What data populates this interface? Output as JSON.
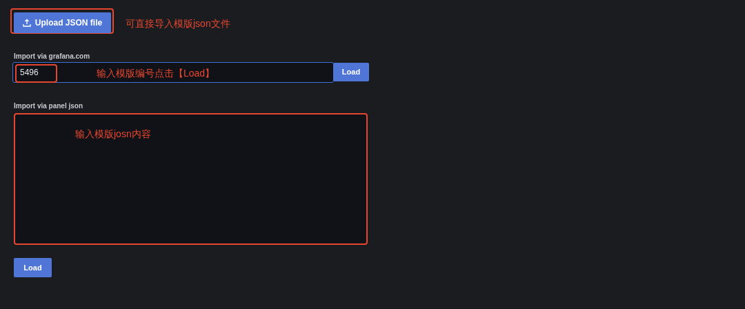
{
  "upload": {
    "label": "Upload JSON file",
    "note": "可直接导入模版json文件"
  },
  "grafana_import": {
    "label": "Import via grafana.com",
    "value": "5496",
    "note": "输入模版编号点击【Load】",
    "button": "Load"
  },
  "panel_import": {
    "label": "Import via panel json",
    "note": "输入模版josn内容"
  },
  "load_button": "Load"
}
